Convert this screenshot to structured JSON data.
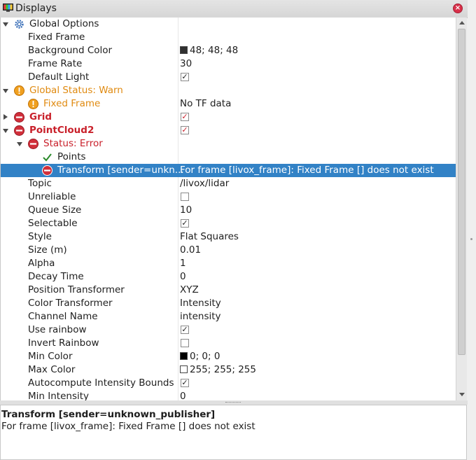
{
  "panel": {
    "title": "Displays",
    "close_icon": "close-icon"
  },
  "rows": {
    "global_options": {
      "label": "Global Options"
    },
    "fixed_frame": {
      "label": "Fixed Frame",
      "value": ""
    },
    "background_color": {
      "label": "Background Color",
      "value": "48; 48; 48",
      "swatch": "#303030"
    },
    "frame_rate": {
      "label": "Frame Rate",
      "value": "30"
    },
    "default_light": {
      "label": "Default Light",
      "checked": true
    },
    "global_status": {
      "label": "Global Status: Warn"
    },
    "status_fixed_frame": {
      "label": "Fixed Frame",
      "value": "No TF data"
    },
    "grid": {
      "label": "Grid",
      "checked": true
    },
    "pointcloud2": {
      "label": "PointCloud2",
      "checked": true
    },
    "status_error": {
      "label": "Status: Error"
    },
    "points": {
      "label": "Points"
    },
    "transform": {
      "label": "Transform [sender=unkn...",
      "value": "For frame [livox_frame]: Fixed Frame [] does not exist"
    },
    "topic": {
      "label": "Topic",
      "value": "/livox/lidar"
    },
    "unreliable": {
      "label": "Unreliable",
      "checked": false
    },
    "queue_size": {
      "label": "Queue Size",
      "value": "10"
    },
    "selectable": {
      "label": "Selectable",
      "checked": true
    },
    "style": {
      "label": "Style",
      "value": "Flat Squares"
    },
    "size": {
      "label": "Size (m)",
      "value": "0.01"
    },
    "alpha": {
      "label": "Alpha",
      "value": "1"
    },
    "decay_time": {
      "label": "Decay Time",
      "value": "0"
    },
    "position_transformer": {
      "label": "Position Transformer",
      "value": "XYZ"
    },
    "color_transformer": {
      "label": "Color Transformer",
      "value": "Intensity"
    },
    "channel_name": {
      "label": "Channel Name",
      "value": "intensity"
    },
    "use_rainbow": {
      "label": "Use rainbow",
      "checked": true
    },
    "invert_rainbow": {
      "label": "Invert Rainbow",
      "checked": false
    },
    "min_color": {
      "label": "Min Color",
      "value": "0; 0; 0",
      "swatch": "#000000"
    },
    "max_color": {
      "label": "Max Color",
      "value": "255; 255; 255",
      "swatch": "#ffffff"
    },
    "autocompute": {
      "label": "Autocompute Intensity Bounds",
      "checked": true
    },
    "min_intensity": {
      "label": "Min Intensity",
      "value": "0"
    }
  },
  "description": {
    "title": "Transform [sender=unknown_publisher]",
    "text": "For frame [livox_frame]: Fixed Frame [] does not exist"
  },
  "colors": {
    "selection": "#3282c6",
    "warn": "#e08a10",
    "error": "#c9202a"
  }
}
